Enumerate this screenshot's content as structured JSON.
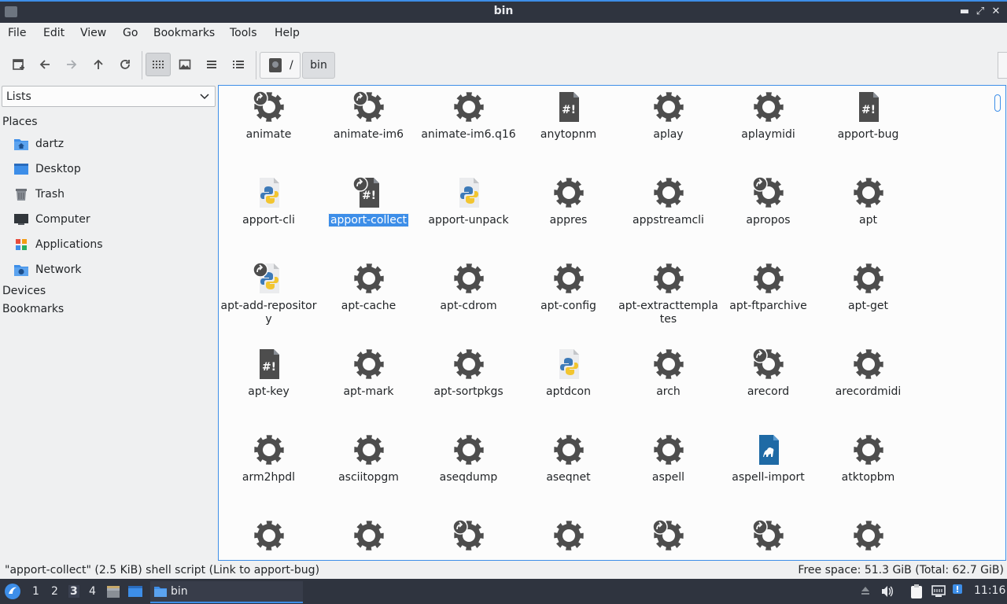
{
  "window": {
    "title": "bin",
    "app_icon": "folder-icon",
    "controls": [
      "minimize-icon",
      "maximize-icon",
      "close-icon"
    ]
  },
  "menubar": {
    "items": [
      "File",
      "Edit",
      "View",
      "Go",
      "Bookmarks",
      "Tools",
      "Help"
    ]
  },
  "toolbar": {
    "buttons": [
      "new-tab-icon",
      "back-icon",
      "forward-icon",
      "up-icon",
      "reload-icon",
      "icon-view-icon",
      "thumbnail-view-icon",
      "compact-view-icon",
      "detailed-list-view-icon"
    ],
    "active_view": "icon-view-icon",
    "path_root": "/",
    "path_current": "bin"
  },
  "sidebar": {
    "selector": "Lists",
    "places_heading": "Places",
    "places": [
      {
        "label": "dartz",
        "icon": "home-folder-icon"
      },
      {
        "label": "Desktop",
        "icon": "desktop-icon"
      },
      {
        "label": "Trash",
        "icon": "trash-icon"
      },
      {
        "label": "Computer",
        "icon": "computer-icon"
      },
      {
        "label": "Applications",
        "icon": "applications-icon"
      },
      {
        "label": "Network",
        "icon": "network-icon"
      }
    ],
    "devices_heading": "Devices",
    "bookmarks_heading": "Bookmarks"
  },
  "files": [
    {
      "name": "animate",
      "icon": "gear",
      "link": true
    },
    {
      "name": "animate-im6",
      "icon": "gear",
      "link": true
    },
    {
      "name": "animate-im6.q16",
      "icon": "gear",
      "link": false
    },
    {
      "name": "anytopnm",
      "icon": "script",
      "link": false
    },
    {
      "name": "aplay",
      "icon": "gear",
      "link": false
    },
    {
      "name": "aplaymidi",
      "icon": "gear",
      "link": false
    },
    {
      "name": "apport-bug",
      "icon": "script",
      "link": false
    },
    {
      "name": "apport-cli",
      "icon": "python",
      "link": false
    },
    {
      "name": "apport-collect",
      "icon": "script",
      "link": true,
      "selected": true
    },
    {
      "name": "apport-unpack",
      "icon": "python",
      "link": false
    },
    {
      "name": "appres",
      "icon": "gear",
      "link": false
    },
    {
      "name": "appstreamcli",
      "icon": "gear",
      "link": false
    },
    {
      "name": "apropos",
      "icon": "gear",
      "link": true
    },
    {
      "name": "apt",
      "icon": "gear",
      "link": false
    },
    {
      "name": "apt-add-repository",
      "icon": "python",
      "link": true
    },
    {
      "name": "apt-cache",
      "icon": "gear",
      "link": false
    },
    {
      "name": "apt-cdrom",
      "icon": "gear",
      "link": false
    },
    {
      "name": "apt-config",
      "icon": "gear",
      "link": false
    },
    {
      "name": "apt-extracttemplates",
      "icon": "gear",
      "link": false
    },
    {
      "name": "apt-ftparchive",
      "icon": "gear",
      "link": false
    },
    {
      "name": "apt-get",
      "icon": "gear",
      "link": false
    },
    {
      "name": "apt-key",
      "icon": "script",
      "link": false
    },
    {
      "name": "apt-mark",
      "icon": "gear",
      "link": false
    },
    {
      "name": "apt-sortpkgs",
      "icon": "gear",
      "link": false
    },
    {
      "name": "aptdcon",
      "icon": "python",
      "link": false
    },
    {
      "name": "arch",
      "icon": "gear",
      "link": false
    },
    {
      "name": "arecord",
      "icon": "gear",
      "link": true
    },
    {
      "name": "arecordmidi",
      "icon": "gear",
      "link": false
    },
    {
      "name": "arm2hpdl",
      "icon": "gear",
      "link": false
    },
    {
      "name": "asciitopgm",
      "icon": "gear",
      "link": false
    },
    {
      "name": "aseqdump",
      "icon": "gear",
      "link": false
    },
    {
      "name": "aseqnet",
      "icon": "gear",
      "link": false
    },
    {
      "name": "aspell",
      "icon": "gear",
      "link": false
    },
    {
      "name": "aspell-import",
      "icon": "perl",
      "link": false
    },
    {
      "name": "atktopbm",
      "icon": "gear",
      "link": false
    },
    {
      "name": "",
      "icon": "gear",
      "link": false
    },
    {
      "name": "",
      "icon": "gear",
      "link": false
    },
    {
      "name": "",
      "icon": "gear",
      "link": true
    },
    {
      "name": "",
      "icon": "gear",
      "link": false
    },
    {
      "name": "",
      "icon": "gear",
      "link": true
    },
    {
      "name": "",
      "icon": "gear",
      "link": true
    },
    {
      "name": "",
      "icon": "gear",
      "link": false
    }
  ],
  "status": {
    "left": "\"apport-collect\" (2.5 KiB) shell script (Link to apport-bug)",
    "right": "Free space: 51.3 GiB (Total: 62.7 GiB)"
  },
  "taskbar": {
    "menu_icon": "lxqt-menu-icon",
    "workspaces": [
      "1",
      "2",
      "3",
      "4"
    ],
    "active_workspace": "3",
    "launchers": [
      "file-manager-launcher-icon",
      "desktop-launcher-icon"
    ],
    "task_label": "bin",
    "tray": [
      "eject-icon",
      "volume-icon",
      "clipboard-icon",
      "network-icon",
      "update-icon"
    ],
    "clock": "11:16"
  },
  "colors": {
    "accent": "#3d8ee8",
    "titlebar": "#2f343f",
    "icon": "#4d4d4d"
  }
}
